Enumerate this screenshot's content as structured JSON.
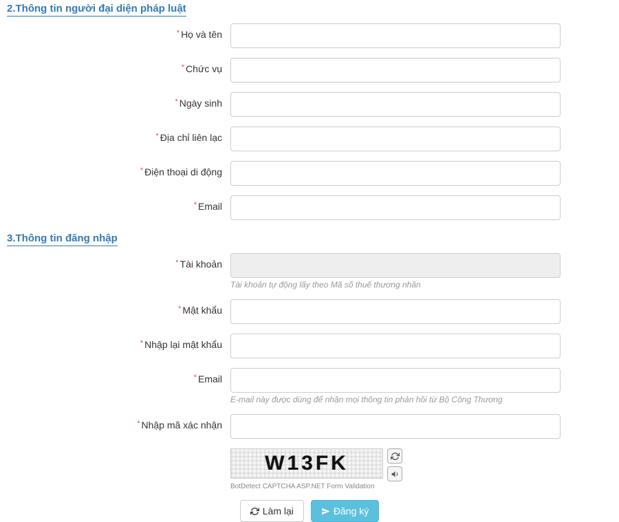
{
  "section2": {
    "heading": "2.Thông tin người đại diện pháp luật",
    "fields": {
      "fullname": "Họ và tên",
      "position": "Chức vụ",
      "dob": "Ngày sinh",
      "address": "Địa chỉ liên lạc",
      "mobile": "Điện thoại di động",
      "email": "Email"
    }
  },
  "section3": {
    "heading": "3.Thông tin đăng nhập",
    "fields": {
      "account": "Tài khoản",
      "account_hint": "Tài khoản tự động lấy theo Mã số thuế thương nhân",
      "password": "Mật khẩu",
      "password_confirm": "Nhập lại mật khẩu",
      "email": "Email",
      "email_hint": "E-mail này được dùng để nhận mọi thông tin phản hồi từ Bộ Công Thương",
      "captcha_label": "Nhập mã xác nhận"
    }
  },
  "captcha": {
    "text": "W13FK",
    "credit": "BotDetect CAPTCHA ASP.NET Form Validation"
  },
  "buttons": {
    "reset": "Làm lại",
    "submit": "Đăng ký"
  }
}
